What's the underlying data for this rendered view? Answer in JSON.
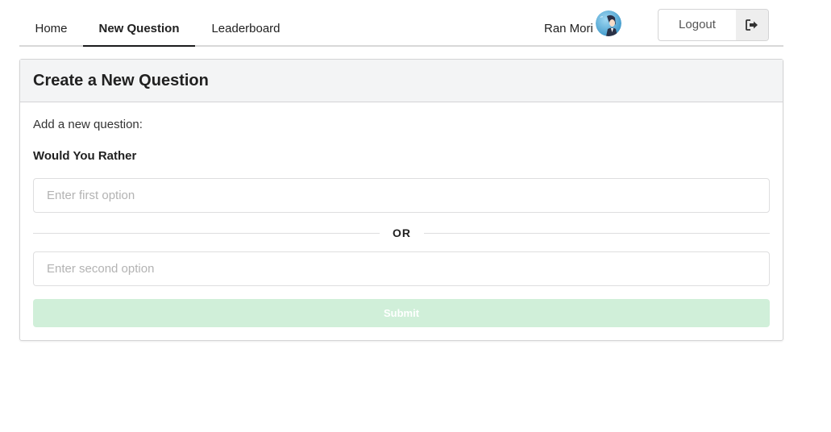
{
  "nav": {
    "items": [
      {
        "label": "Home",
        "active": false
      },
      {
        "label": "New Question",
        "active": true
      },
      {
        "label": "Leaderboard",
        "active": false
      }
    ],
    "user_name": "Ran Mori",
    "logout_label": "Logout",
    "logout_icon": "sign-out-icon"
  },
  "card": {
    "title": "Create a New Question",
    "prompt": "Add a new question:",
    "subtitle": "Would You Rather",
    "option_one": {
      "value": "",
      "placeholder": "Enter first option"
    },
    "divider_label": "OR",
    "option_two": {
      "value": "",
      "placeholder": "Enter second option"
    },
    "submit_label": "Submit",
    "submit_disabled": true
  },
  "colors": {
    "submit_disabled_bg": "#d0efd9",
    "header_bg": "#f3f4f5",
    "active_underline": "#1b1c1d"
  }
}
